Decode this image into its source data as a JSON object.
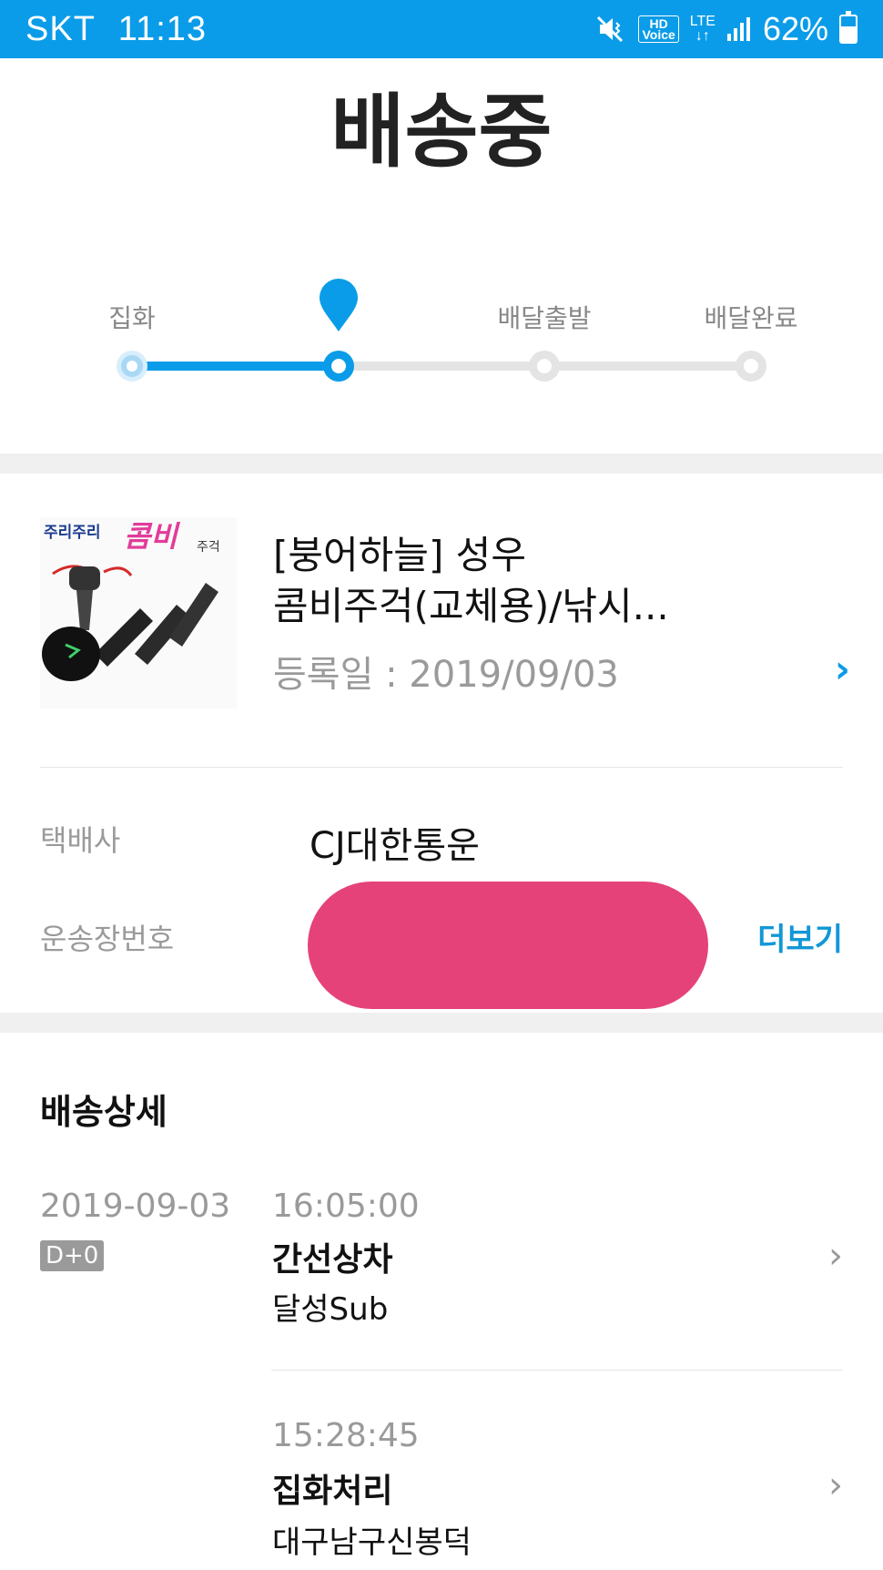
{
  "status_bar": {
    "carrier": "SKT",
    "time": "11:13",
    "hd_voice_top": "HD",
    "hd_voice_bottom": "Voice",
    "network": "LTE",
    "battery_percent_text": "62%",
    "battery_level": 0.62
  },
  "header": {
    "title": "배송중"
  },
  "tracker": {
    "steps": [
      {
        "label": "집화",
        "state": "done"
      },
      {
        "label": "",
        "state": "current"
      },
      {
        "label": "배달출발",
        "state": "todo"
      },
      {
        "label": "배달완료",
        "state": "todo"
      }
    ],
    "accent_color": "#0a9ce8"
  },
  "product": {
    "thumbnail_text_1": "주리주리",
    "thumbnail_text_2": "콤비",
    "thumbnail_text_3": "주걱",
    "name_line1": "[붕어하늘] 성우",
    "name_line2": "콤비주걱(교체용)/낚시...",
    "registered_date": "등록일 : 2019/09/03"
  },
  "courier": {
    "company_label": "택배사",
    "company_value": "CJ대한통운",
    "tracking_label": "운송장번호",
    "more_label": "더보기",
    "redaction_color": "#e5427a"
  },
  "detail": {
    "title": "배송상세",
    "events": [
      {
        "date": "2019-09-03",
        "time": "16:05:00",
        "badge": "D+0",
        "status": "간선상차",
        "location": "달성Sub"
      },
      {
        "date": "",
        "time": "15:28:45",
        "badge": "",
        "status": "집화처리",
        "location": "대구남구신봉덕"
      }
    ]
  }
}
